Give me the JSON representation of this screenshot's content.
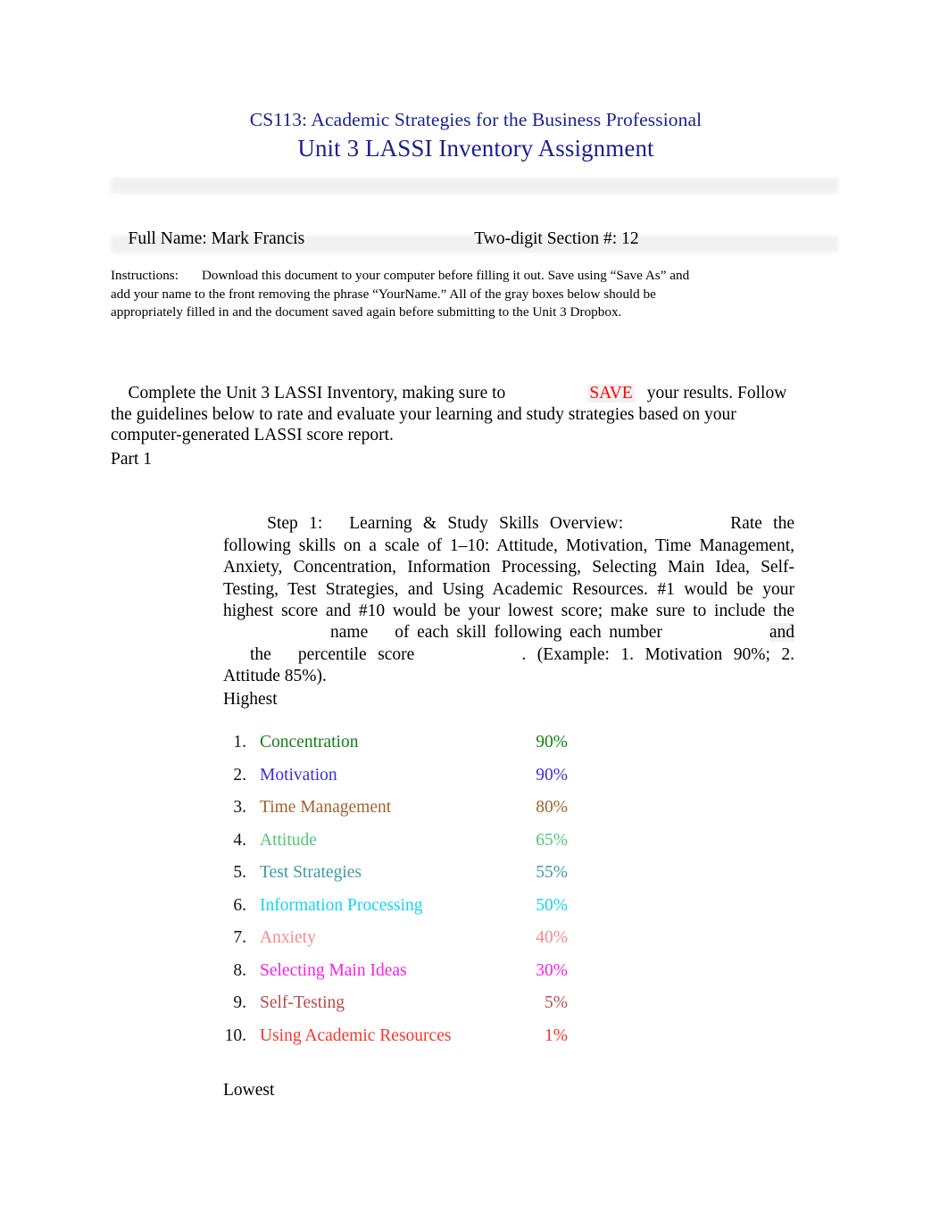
{
  "document": {
    "course_title": "CS113: Academic Strategies for the Business Professional",
    "assignment_title": "Unit 3 LASSI Inventory Assignment",
    "title_color": "#1d1d8f"
  },
  "header_fields": {
    "full_name": "Full Name: Mark Francis",
    "section_number": "Two-digit Section #: 12"
  },
  "instructions": {
    "label": "Instructions:",
    "text": "Download this document to your computer before filling it out. Save using “Save As” and add your name to the front removing the phrase “YourName.” All of the gray boxes below should be appropriately filled in and the document saved again before submitting to the Unit 3 Dropbox."
  },
  "complete_paragraph": {
    "before_save": "Complete the Unit 3 LASSI Inventory, making sure to",
    "save_word": "SAVE",
    "save_color": "#ff0000",
    "after_save": "your results. Follow the guidelines below to rate and evaluate your learning and study strategies based on your computer-generated LASSI score report."
  },
  "part_label": "Part 1",
  "step": {
    "label": "Step 1:",
    "heading": "Learning & Study Skills Overview:",
    "body_part_1": "Rate the following skills on a scale of 1–10: Attitude, Motivation, Time Management, Anxiety, Concentration, Information Processing, Selecting Main Idea, Self-Testing, Test Strategies, and Using Academic Resources. #1 would be your highest score and #10 would be your lowest score; make sure to include the",
    "body_word_name": "name",
    "body_word_of": "of",
    "body_part_2": "each skill following each number",
    "body_word_and": "and",
    "body_word_the": "the",
    "body_word_percentile": "percentile score",
    "body_period": ".",
    "body_part_3": "(Example: 1. Motivation 90%; 2. Attitude 85%)."
  },
  "scale_labels": {
    "highest": "Highest",
    "lowest": "Lowest"
  },
  "skills": [
    {
      "rank": "1.",
      "name": "Concentration",
      "percent": "90%",
      "color": "#128012"
    },
    {
      "rank": "2.",
      "name": "Motivation",
      "percent": "90%",
      "color": "#3b2ee0"
    },
    {
      "rank": "3.",
      "name": "Time Management",
      "percent": "80%",
      "color": "#a0622d"
    },
    {
      "rank": "4.",
      "name": "Attitude",
      "percent": "65%",
      "color": "#4fc77a"
    },
    {
      "rank": "5.",
      "name": "Test Strategies",
      "percent": "55%",
      "color": "#3d9aa2"
    },
    {
      "rank": "6.",
      "name": "Information Processing",
      "percent": "50%",
      "color": "#12d5f5"
    },
    {
      "rank": "7.",
      "name": "Anxiety",
      "percent": "40%",
      "color": "#f58a8a"
    },
    {
      "rank": "8.",
      "name": "Selecting Main Ideas",
      "percent": "30%",
      "color": "#f221e8"
    },
    {
      "rank": "9.",
      "name": "Self-Testing",
      "percent": "5%",
      "color": "#b74b4b"
    },
    {
      "rank": "10.",
      "name": "Using Academic Resources",
      "percent": "1%",
      "color": "#f6352a"
    }
  ]
}
